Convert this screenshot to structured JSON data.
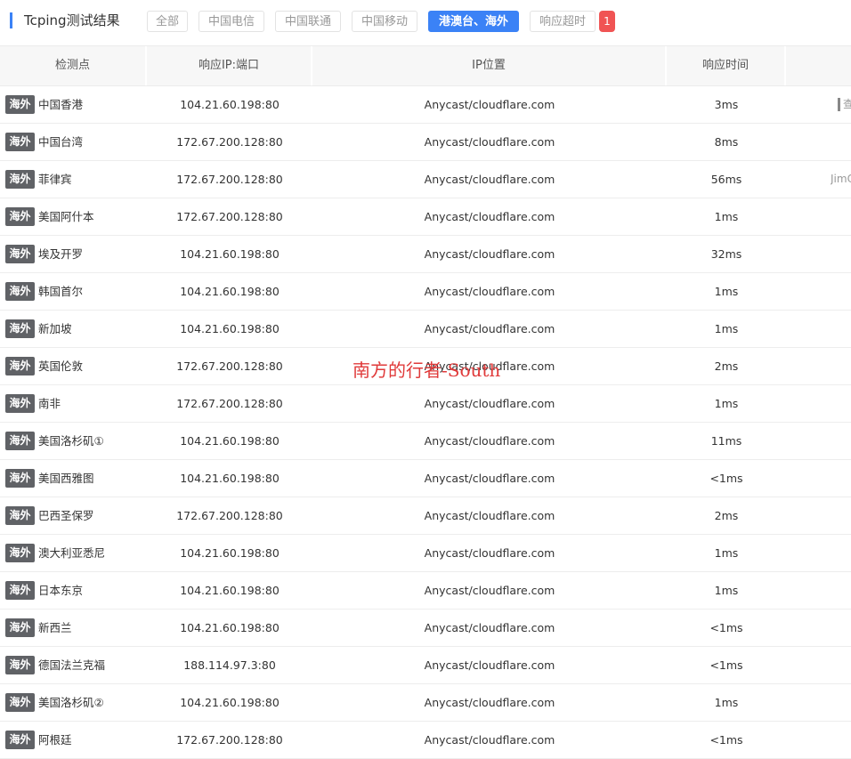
{
  "header": {
    "title": "Tcping测试结果",
    "filters": [
      "全部",
      "中国电信",
      "中国联通",
      "中国移动",
      "港澳台、海外",
      "响应超时"
    ],
    "active_filter": "港澳台、海外",
    "timeout_count": "1"
  },
  "table": {
    "columns": [
      "检测点",
      "响应IP:端口",
      "IP位置",
      "响应时间",
      ""
    ],
    "rows": [
      {
        "tag": "海外",
        "location": "中国香港",
        "ip": "104.21.60.198:80",
        "ip_location": "Anycast/cloudflare.com",
        "time": "3ms",
        "extra": "查"
      },
      {
        "tag": "海外",
        "location": "中国台湾",
        "ip": "172.67.200.128:80",
        "ip_location": "Anycast/cloudflare.com",
        "time": "8ms",
        "extra": ""
      },
      {
        "tag": "海外",
        "location": "菲律宾",
        "ip": "172.67.200.128:80",
        "ip_location": "Anycast/cloudflare.com",
        "time": "56ms",
        "extra": "JimC"
      },
      {
        "tag": "海外",
        "location": "美国阿什本",
        "ip": "172.67.200.128:80",
        "ip_location": "Anycast/cloudflare.com",
        "time": "1ms",
        "extra": ""
      },
      {
        "tag": "海外",
        "location": "埃及开罗",
        "ip": "104.21.60.198:80",
        "ip_location": "Anycast/cloudflare.com",
        "time": "32ms",
        "extra": ""
      },
      {
        "tag": "海外",
        "location": "韩国首尔",
        "ip": "104.21.60.198:80",
        "ip_location": "Anycast/cloudflare.com",
        "time": "1ms",
        "extra": ""
      },
      {
        "tag": "海外",
        "location": "新加坡",
        "ip": "104.21.60.198:80",
        "ip_location": "Anycast/cloudflare.com",
        "time": "1ms",
        "extra": ""
      },
      {
        "tag": "海外",
        "location": "英国伦敦",
        "ip": "172.67.200.128:80",
        "ip_location": "Anycast/cloudflare.com",
        "time": "2ms",
        "extra": ""
      },
      {
        "tag": "海外",
        "location": "南非",
        "ip": "172.67.200.128:80",
        "ip_location": "Anycast/cloudflare.com",
        "time": "1ms",
        "extra": ""
      },
      {
        "tag": "海外",
        "location": "美国洛杉矶①",
        "ip": "104.21.60.198:80",
        "ip_location": "Anycast/cloudflare.com",
        "time": "11ms",
        "extra": ""
      },
      {
        "tag": "海外",
        "location": "美国西雅图",
        "ip": "104.21.60.198:80",
        "ip_location": "Anycast/cloudflare.com",
        "time": "<1ms",
        "extra": ""
      },
      {
        "tag": "海外",
        "location": "巴西圣保罗",
        "ip": "172.67.200.128:80",
        "ip_location": "Anycast/cloudflare.com",
        "time": "2ms",
        "extra": ""
      },
      {
        "tag": "海外",
        "location": "澳大利亚悉尼",
        "ip": "104.21.60.198:80",
        "ip_location": "Anycast/cloudflare.com",
        "time": "1ms",
        "extra": ""
      },
      {
        "tag": "海外",
        "location": "日本东京",
        "ip": "104.21.60.198:80",
        "ip_location": "Anycast/cloudflare.com",
        "time": "1ms",
        "extra": ""
      },
      {
        "tag": "海外",
        "location": "新西兰",
        "ip": "104.21.60.198:80",
        "ip_location": "Anycast/cloudflare.com",
        "time": "<1ms",
        "extra": ""
      },
      {
        "tag": "海外",
        "location": "德国法兰克福",
        "ip": "188.114.97.3:80",
        "ip_location": "Anycast/cloudflare.com",
        "time": "<1ms",
        "extra": ""
      },
      {
        "tag": "海外",
        "location": "美国洛杉矶②",
        "ip": "104.21.60.198:80",
        "ip_location": "Anycast/cloudflare.com",
        "time": "1ms",
        "extra": ""
      },
      {
        "tag": "海外",
        "location": "阿根廷",
        "ip": "172.67.200.128:80",
        "ip_location": "Anycast/cloudflare.com",
        "time": "<1ms",
        "extra": ""
      }
    ]
  },
  "watermark": "南方的行者-South",
  "colors": {
    "accent": "#3b82f6",
    "tag_bg": "#606266",
    "alert": "#f05454",
    "watermark": "#e03a3a"
  }
}
